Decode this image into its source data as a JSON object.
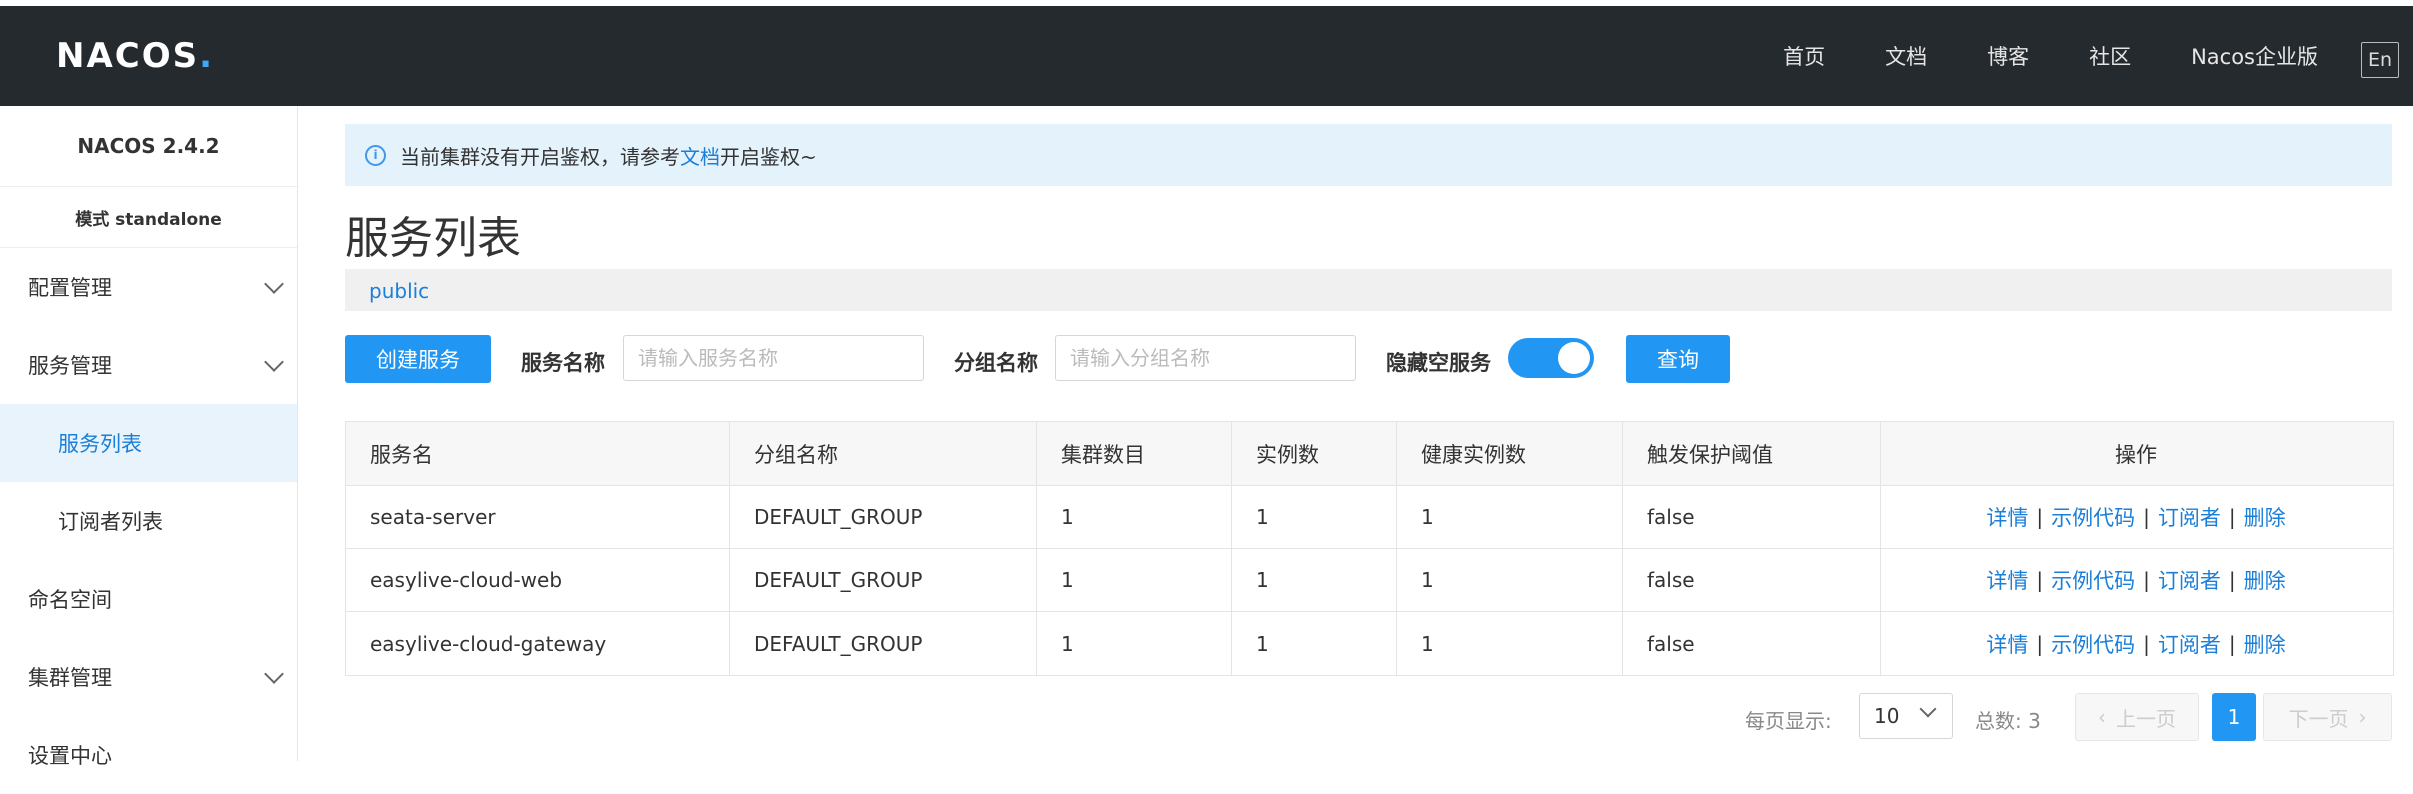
{
  "header": {
    "logo": "NACOS",
    "nav": [
      "首页",
      "文档",
      "博客",
      "社区",
      "Nacos企业版"
    ],
    "lang_button": "En"
  },
  "sidebar": {
    "version": "NACOS 2.4.2",
    "mode": "模式 standalone",
    "items": [
      {
        "label": "配置管理"
      },
      {
        "label": "服务管理"
      },
      {
        "label": "服务列表"
      },
      {
        "label": "订阅者列表"
      },
      {
        "label": "命名空间"
      },
      {
        "label": "集群管理"
      },
      {
        "label": "设置中心"
      }
    ]
  },
  "notice": {
    "prefix": "当前集群没有开启鉴权，请参考",
    "link": "文档",
    "suffix": "开启鉴权~"
  },
  "page": {
    "title": "服务列表",
    "namespace": "public"
  },
  "filters": {
    "create_button": "创建服务",
    "service_name_label": "服务名称",
    "service_name_placeholder": "请输入服务名称",
    "group_name_label": "分组名称",
    "group_name_placeholder": "请输入分组名称",
    "hide_empty_label": "隐藏空服务",
    "hide_empty_on": true,
    "query_button": "查询"
  },
  "table": {
    "columns": [
      "服务名",
      "分组名称",
      "集群数目",
      "实例数",
      "健康实例数",
      "触发保护阈值",
      "操作"
    ],
    "rows": [
      [
        "seata-server",
        "DEFAULT_GROUP",
        "1",
        "1",
        "1",
        "false"
      ],
      [
        "easylive-cloud-web",
        "DEFAULT_GROUP",
        "1",
        "1",
        "1",
        "false"
      ],
      [
        "easylive-cloud-gateway",
        "DEFAULT_GROUP",
        "1",
        "1",
        "1",
        "false"
      ]
    ],
    "actions": [
      "详情",
      "示例代码",
      "订阅者",
      "删除"
    ]
  },
  "pagination": {
    "per_page_label": "每页显示:",
    "per_page_value": "10",
    "total_label": "总数: 3",
    "prev": "上一页",
    "current": "1",
    "next": "下一页"
  },
  "colors": {
    "topbar": "#252a2f",
    "primary": "#2196f3",
    "link": "#1a7fd8",
    "notice_bg": "#e4f2fc"
  }
}
